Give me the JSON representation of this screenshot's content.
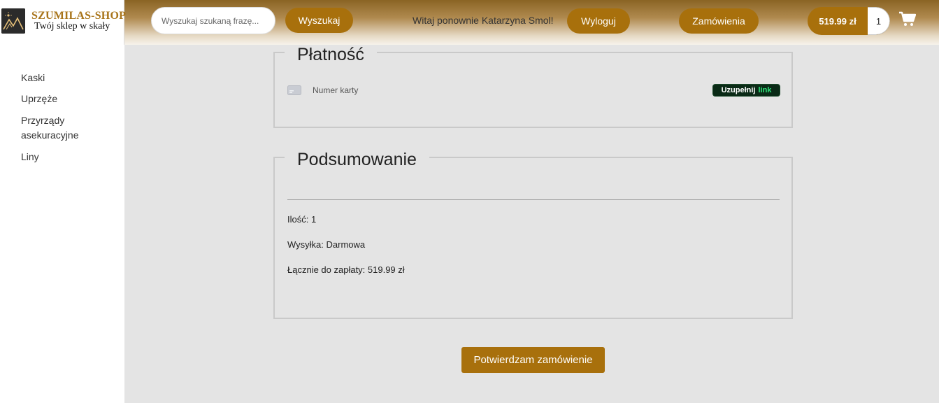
{
  "header": {
    "logo_title": "SZUMILAS-SHOP",
    "logo_subtitle": "Twój sklep w skały",
    "search_placeholder": "Wyszukaj szukaną frazę...",
    "search_button": "Wyszukaj",
    "welcome_text": "Witaj ponownie Katarzyna Smol!",
    "logout_button": "Wyloguj",
    "orders_button": "Zamówienia",
    "cart_total": "519.99 zł",
    "cart_count": "1",
    "icons": {
      "cart": "shopping-cart-icon",
      "logo": "mountains-logo-icon"
    }
  },
  "sidebar": {
    "items": [
      {
        "label": "Kaski"
      },
      {
        "label": "Uprzęże"
      },
      {
        "label": "Przyrządy asekuracyjne"
      },
      {
        "label": "Liny"
      }
    ]
  },
  "payment": {
    "legend": "Płatność",
    "card_placeholder": "Numer karty",
    "autofill_fill": "Uzupełnij",
    "autofill_brand": "link",
    "icons": {
      "card": "credit-card-icon"
    }
  },
  "summary": {
    "legend": "Podsumowanie",
    "quantity": "Ilość: 1",
    "shipping": "Wysyłka: Darmowa",
    "total": "Łącznie do zapłaty: 519.99 zł"
  },
  "confirm_button": "Potwierdzam zamówienie",
  "colors": {
    "accent": "#a8700c",
    "page_bg": "#e4e4e4",
    "link_badge_bg": "#0a2a16",
    "link_brand": "#2ee57a"
  }
}
